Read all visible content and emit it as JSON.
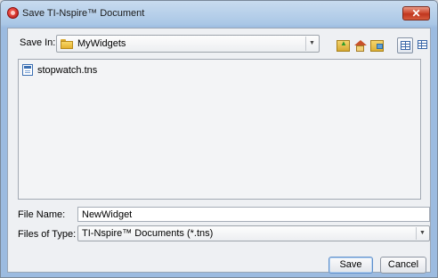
{
  "window": {
    "title": "Save TI-Nspire™ Document",
    "close_label": "✕"
  },
  "save_in": {
    "label": "Save In:",
    "folder": "MyWidgets"
  },
  "files": [
    {
      "name": "stopwatch.tns"
    }
  ],
  "file_name": {
    "label": "File Name:",
    "value": "NewWidget"
  },
  "file_type": {
    "label": "Files of Type:",
    "value": "TI-Nspire™ Documents (*.tns)"
  },
  "buttons": {
    "save": "Save",
    "cancel": "Cancel"
  },
  "icons": [
    "folder-icon",
    "up-one-level-icon",
    "home-icon",
    "new-folder-icon",
    "list-view-icon",
    "details-view-icon",
    "tns-file-icon",
    "chevron-down-icon",
    "close-icon"
  ]
}
